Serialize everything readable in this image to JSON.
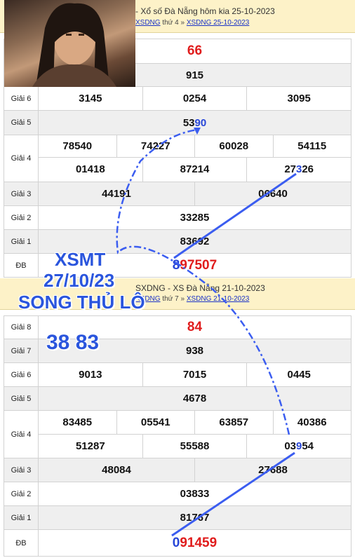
{
  "block1": {
    "title": "- Xổ số Đà Nẵng hôm kia 25-10-2023",
    "crumb_sep1": "thứ 4 »",
    "crumb_link1": "XSDNG",
    "crumb_link2": "XSDNG 25-10-2023",
    "g8": "66",
    "g7": "915",
    "g6": [
      "3145",
      "0254",
      "3095"
    ],
    "g5_a": "53",
    "g5_b": "90",
    "g4_row1": [
      "78540",
      "74227",
      "60028",
      "54115"
    ],
    "g4_row2": [
      "01418",
      "87214"
    ],
    "g4_last_a": "27",
    "g4_last_b": "3",
    "g4_last_c": "26",
    "g3": [
      "44191",
      "06640"
    ],
    "g2": "33285",
    "g1": "83692",
    "db_first": "8",
    "db_rest": "97507"
  },
  "block2": {
    "title": "SXDNG - XS Đà Nẵng 21-10-2023",
    "crumb_sep1": "thứ 7 »",
    "crumb_link1": "XSDNG",
    "crumb_link2": "XSDNG 21-10-2023",
    "g8": "84",
    "g7": "938",
    "g6": [
      "9013",
      "7015",
      "0445"
    ],
    "g5": "4678",
    "g4_row1": [
      "83485",
      "05541",
      "63857",
      "40386"
    ],
    "g4_row2": [
      "51287",
      "55588"
    ],
    "g4_last_a": "03",
    "g4_last_b": "9",
    "g4_last_c": "54",
    "g3": [
      "48084",
      "27688"
    ],
    "g2": "03833",
    "g1": "81767",
    "db_first": "0",
    "db_rest": "91459"
  },
  "labels": {
    "g8": "Giải 8",
    "g7": "Giải 7",
    "g6": "Giải 6",
    "g5": "Giải 5",
    "g4": "Giải 4",
    "g3": "Giải 3",
    "g2": "Giải 2",
    "g1": "Giải 1",
    "db": "ĐB"
  },
  "overlay": {
    "line1": "XSMT",
    "line2": "27/10/23",
    "line3": "SONG THỦ LÔ",
    "numbers": "38 83"
  },
  "colors": {
    "red": "#e01c1c",
    "blue": "#2746d8",
    "header_bg": "#fdf2c8"
  }
}
